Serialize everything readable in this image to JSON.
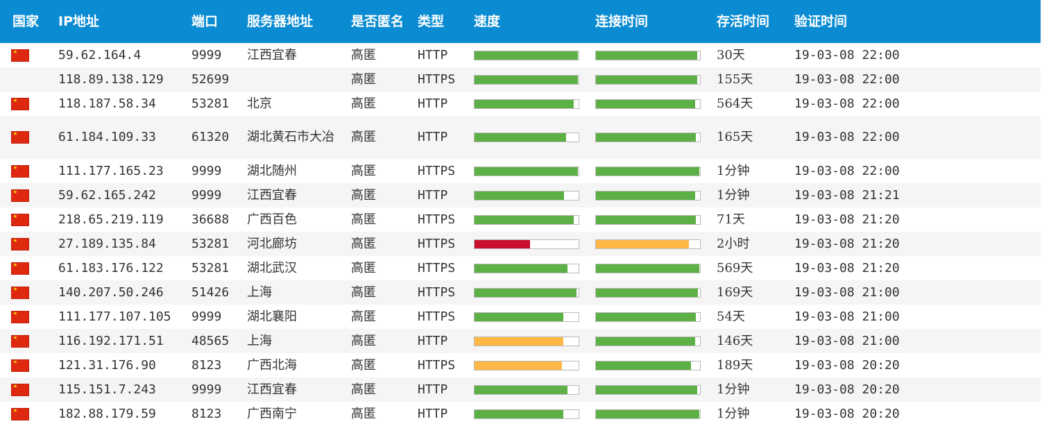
{
  "headers": {
    "country": "国家",
    "ip": "IP地址",
    "port": "端口",
    "server": "服务器地址",
    "anonymity": "是否匿名",
    "type": "类型",
    "speed": "速度",
    "connect": "连接时间",
    "alive": "存活时间",
    "verified": "验证时间"
  },
  "colors": {
    "header_bg": "#0b8cd2",
    "good": "#5db045",
    "medium": "#ffb846",
    "bad": "#c8102e"
  },
  "rows": [
    {
      "flag": true,
      "ip": "59.62.164.4",
      "port": "9999",
      "server": "江西宜春",
      "anon": "高匿",
      "type": "HTTP",
      "speed": {
        "pct": 99,
        "level": "good"
      },
      "conn": {
        "pct": 97,
        "level": "good"
      },
      "alive": "30天",
      "verified": "19-03-08 22:00"
    },
    {
      "flag": false,
      "ip": "118.89.138.129",
      "port": "52699",
      "server": "",
      "anon": "高匿",
      "type": "HTTPS",
      "speed": {
        "pct": 99,
        "level": "good"
      },
      "conn": {
        "pct": 97,
        "level": "good"
      },
      "alive": "155天",
      "verified": "19-03-08 22:00"
    },
    {
      "flag": true,
      "ip": "118.187.58.34",
      "port": "53281",
      "server": "北京",
      "anon": "高匿",
      "type": "HTTP",
      "speed": {
        "pct": 95,
        "level": "good"
      },
      "conn": {
        "pct": 95,
        "level": "good"
      },
      "alive": "564天",
      "verified": "19-03-08 22:00"
    },
    {
      "flag": true,
      "ip": "61.184.109.33",
      "port": "61320",
      "server": "湖北黄石市大冶",
      "anon": "高匿",
      "type": "HTTP",
      "speed": {
        "pct": 88,
        "level": "good"
      },
      "conn": {
        "pct": 96,
        "level": "good"
      },
      "alive": "165天",
      "verified": "19-03-08 22:00"
    },
    {
      "flag": true,
      "ip": "111.177.165.23",
      "port": "9999",
      "server": "湖北随州",
      "anon": "高匿",
      "type": "HTTPS",
      "speed": {
        "pct": 99,
        "level": "good"
      },
      "conn": {
        "pct": 99,
        "level": "good"
      },
      "alive": "1分钟",
      "verified": "19-03-08 22:00"
    },
    {
      "flag": true,
      "ip": "59.62.165.242",
      "port": "9999",
      "server": "江西宜春",
      "anon": "高匿",
      "type": "HTTP",
      "speed": {
        "pct": 86,
        "level": "good"
      },
      "conn": {
        "pct": 95,
        "level": "good"
      },
      "alive": "1分钟",
      "verified": "19-03-08 21:21"
    },
    {
      "flag": true,
      "ip": "218.65.219.119",
      "port": "36688",
      "server": "广西百色",
      "anon": "高匿",
      "type": "HTTPS",
      "speed": {
        "pct": 95,
        "level": "good"
      },
      "conn": {
        "pct": 96,
        "level": "good"
      },
      "alive": "71天",
      "verified": "19-03-08 21:20"
    },
    {
      "flag": true,
      "ip": "27.189.135.84",
      "port": "53281",
      "server": "河北廊坊",
      "anon": "高匿",
      "type": "HTTPS",
      "speed": {
        "pct": 53,
        "level": "bad"
      },
      "conn": {
        "pct": 89,
        "level": "medium"
      },
      "alive": "2小时",
      "verified": "19-03-08 21:20"
    },
    {
      "flag": true,
      "ip": "61.183.176.122",
      "port": "53281",
      "server": "湖北武汉",
      "anon": "高匿",
      "type": "HTTPS",
      "speed": {
        "pct": 89,
        "level": "good"
      },
      "conn": {
        "pct": 99,
        "level": "good"
      },
      "alive": "569天",
      "verified": "19-03-08 21:20"
    },
    {
      "flag": true,
      "ip": "140.207.50.246",
      "port": "51426",
      "server": "上海",
      "anon": "高匿",
      "type": "HTTPS",
      "speed": {
        "pct": 98,
        "level": "good"
      },
      "conn": {
        "pct": 98,
        "level": "good"
      },
      "alive": "169天",
      "verified": "19-03-08 21:00"
    },
    {
      "flag": true,
      "ip": "111.177.107.105",
      "port": "9999",
      "server": "湖北襄阳",
      "anon": "高匿",
      "type": "HTTPS",
      "speed": {
        "pct": 85,
        "level": "good"
      },
      "conn": {
        "pct": 96,
        "level": "good"
      },
      "alive": "54天",
      "verified": "19-03-08 21:00"
    },
    {
      "flag": true,
      "ip": "116.192.171.51",
      "port": "48565",
      "server": "上海",
      "anon": "高匿",
      "type": "HTTP",
      "speed": {
        "pct": 85,
        "level": "medium"
      },
      "conn": {
        "pct": 95,
        "level": "good"
      },
      "alive": "146天",
      "verified": "19-03-08 21:00"
    },
    {
      "flag": true,
      "ip": "121.31.176.90",
      "port": "8123",
      "server": "广西北海",
      "anon": "高匿",
      "type": "HTTPS",
      "speed": {
        "pct": 84,
        "level": "medium"
      },
      "conn": {
        "pct": 91,
        "level": "good"
      },
      "alive": "189天",
      "verified": "19-03-08 20:20"
    },
    {
      "flag": true,
      "ip": "115.151.7.243",
      "port": "9999",
      "server": "江西宜春",
      "anon": "高匿",
      "type": "HTTP",
      "speed": {
        "pct": 89,
        "level": "good"
      },
      "conn": {
        "pct": 97,
        "level": "good"
      },
      "alive": "1分钟",
      "verified": "19-03-08 20:20"
    },
    {
      "flag": true,
      "ip": "182.88.179.59",
      "port": "8123",
      "server": "广西南宁",
      "anon": "高匿",
      "type": "HTTP",
      "speed": {
        "pct": 85,
        "level": "good"
      },
      "conn": {
        "pct": 99,
        "level": "good"
      },
      "alive": "1分钟",
      "verified": "19-03-08 20:20"
    }
  ]
}
